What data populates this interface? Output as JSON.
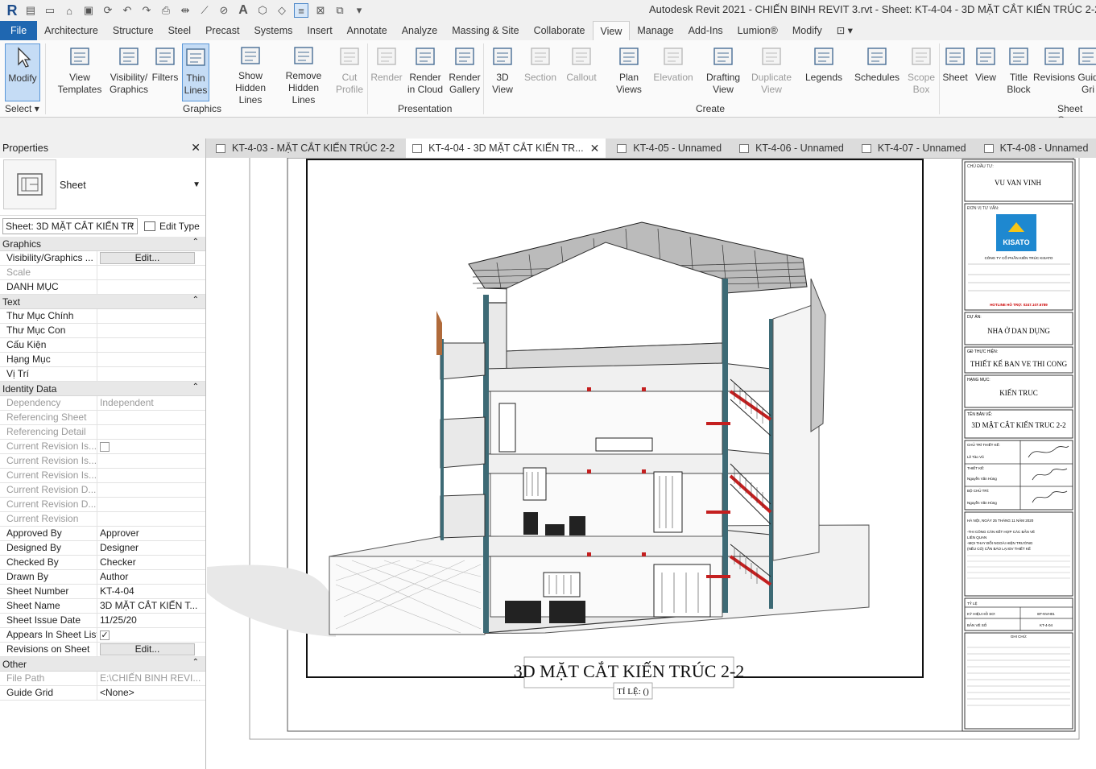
{
  "window": {
    "title": "Autodesk Revit 2021 - CHIẾN BINH REVIT 3.rvt - Sheet: KT-4-04 - 3D MẶT CẮT KIẾN TRÚC 2-2"
  },
  "ribbon_tabs": [
    "File",
    "Architecture",
    "Structure",
    "Steel",
    "Precast",
    "Systems",
    "Insert",
    "Annotate",
    "Analyze",
    "Massing & Site",
    "Collaborate",
    "View",
    "Manage",
    "Add-Ins",
    "Lumion®",
    "Modify"
  ],
  "active_tab": "View",
  "select_label": "Select",
  "ribbon_buttons": [
    {
      "l1": "Modify",
      "l2": "",
      "icon": "cursor-icon"
    },
    {
      "l1": "View",
      "l2": "Templates",
      "icon": "view-templates-icon"
    },
    {
      "l1": "Visibility/",
      "l2": "Graphics",
      "icon": "visibility-graphics-icon"
    },
    {
      "l1": "Filters",
      "l2": "",
      "icon": "filters-icon"
    },
    {
      "l1": "Thin",
      "l2": "Lines",
      "icon": "thin-lines-icon"
    },
    {
      "l1": "Show",
      "l2": "Hidden Lines",
      "icon": "show-hidden-lines-icon"
    },
    {
      "l1": "Remove",
      "l2": "Hidden Lines",
      "icon": "remove-hidden-lines-icon"
    },
    {
      "l1": "Cut",
      "l2": "Profile",
      "icon": "cut-profile-icon"
    },
    {
      "l1": "Render",
      "l2": "",
      "icon": "render-icon"
    },
    {
      "l1": "Render",
      "l2": "in Cloud",
      "icon": "render-cloud-icon"
    },
    {
      "l1": "Render",
      "l2": "Gallery",
      "icon": "render-gallery-icon"
    },
    {
      "l1": "3D",
      "l2": "View",
      "icon": "3d-view-icon"
    },
    {
      "l1": "Section",
      "l2": "",
      "icon": "section-icon"
    },
    {
      "l1": "Callout",
      "l2": "",
      "icon": "callout-icon"
    },
    {
      "l1": "Plan",
      "l2": "Views",
      "icon": "plan-views-icon"
    },
    {
      "l1": "Elevation",
      "l2": "",
      "icon": "elevation-icon"
    },
    {
      "l1": "Drafting",
      "l2": "View",
      "icon": "drafting-view-icon"
    },
    {
      "l1": "Duplicate",
      "l2": "View",
      "icon": "duplicate-view-icon"
    },
    {
      "l1": "Legends",
      "l2": "",
      "icon": "legends-icon"
    },
    {
      "l1": "Schedules",
      "l2": "",
      "icon": "schedules-icon"
    },
    {
      "l1": "Scope",
      "l2": "Box",
      "icon": "scope-box-icon"
    },
    {
      "l1": "Sheet",
      "l2": "",
      "icon": "sheet-icon"
    },
    {
      "l1": "View",
      "l2": "",
      "icon": "place-view-icon"
    },
    {
      "l1": "Title",
      "l2": "Block",
      "icon": "title-block-icon"
    },
    {
      "l1": "Revisions",
      "l2": "",
      "icon": "revisions-icon"
    },
    {
      "l1": "Guid",
      "l2": "Gri",
      "icon": "guide-grid-icon"
    }
  ],
  "ribbon_groups": [
    "Graphics",
    "Presentation",
    "Create",
    "Sheet Co"
  ],
  "properties": {
    "title": "Properties",
    "type_name": "Sheet",
    "selector": "Sheet: 3D MẶT CẮT KIẾN TR",
    "edit_type": "Edit Type",
    "sections": [
      {
        "name": "Graphics",
        "rows": [
          {
            "k": "Visibility/Graphics ...",
            "v": "Edit...",
            "btn": true
          },
          {
            "k": "Scale",
            "v": "",
            "dim": true
          },
          {
            "k": "DANH MỤC",
            "v": ""
          }
        ]
      },
      {
        "name": "Text",
        "rows": [
          {
            "k": "Thư Mục Chính",
            "v": ""
          },
          {
            "k": "Thư Mục Con",
            "v": ""
          },
          {
            "k": "Cấu Kiện",
            "v": ""
          },
          {
            "k": "Hạng Mục",
            "v": ""
          },
          {
            "k": "Vị Trí",
            "v": ""
          }
        ]
      },
      {
        "name": "Identity Data",
        "rows": [
          {
            "k": "Dependency",
            "v": "Independent",
            "dim": true
          },
          {
            "k": "Referencing Sheet",
            "v": "",
            "dim": true
          },
          {
            "k": "Referencing Detail",
            "v": "",
            "dim": true
          },
          {
            "k": "Current Revision Is...",
            "v": "",
            "dim": true,
            "chk": "unchecked"
          },
          {
            "k": "Current Revision Is...",
            "v": "",
            "dim": true
          },
          {
            "k": "Current Revision Is...",
            "v": "",
            "dim": true
          },
          {
            "k": "Current Revision D...",
            "v": "",
            "dim": true
          },
          {
            "k": "Current Revision D...",
            "v": "",
            "dim": true
          },
          {
            "k": "Current Revision",
            "v": "",
            "dim": true
          },
          {
            "k": "Approved By",
            "v": "Approver"
          },
          {
            "k": "Designed By",
            "v": "Designer"
          },
          {
            "k": "Checked By",
            "v": "Checker"
          },
          {
            "k": "Drawn By",
            "v": "Author"
          },
          {
            "k": "Sheet Number",
            "v": "KT-4-04"
          },
          {
            "k": "Sheet Name",
            "v": "3D MẶT CẮT KIẾN T..."
          },
          {
            "k": "Sheet Issue Date",
            "v": "11/25/20"
          },
          {
            "k": "Appears In Sheet List",
            "v": "",
            "chk": "checked"
          },
          {
            "k": "Revisions on Sheet",
            "v": "Edit...",
            "btn": true
          }
        ]
      },
      {
        "name": "Other",
        "rows": [
          {
            "k": "File Path",
            "v": "E:\\CHIẾN BINH REVI...",
            "dim": true
          },
          {
            "k": "Guide Grid",
            "v": "<None>"
          }
        ]
      }
    ]
  },
  "doc_tabs": [
    {
      "label": "KT-4-03 - MẶT CẮT KIẾN TRÚC 2-2",
      "active": false
    },
    {
      "label": "KT-4-04 - 3D MẶT CẮT KIẾN TR...",
      "active": true
    },
    {
      "label": "KT-4-05 - Unnamed",
      "active": false
    },
    {
      "label": "KT-4-06 - Unnamed",
      "active": false
    },
    {
      "label": "KT-4-07 - Unnamed",
      "active": false
    },
    {
      "label": "KT-4-08 - Unnamed",
      "active": false
    }
  ],
  "sheet": {
    "view_title": "3D MẶT CẮT KIẾN TRÚC 2-2",
    "scale_label": "TỈ LỆ: ()",
    "title_block": {
      "owner_label": "CHỦ ĐẦU TƯ:",
      "owner": "VU VAN VINH",
      "consultant_label": "ĐƠN VỊ TƯ VẤN:",
      "logo_text": "KISATO",
      "company": "CÔNG TY CỔ PHẦN KIẾN TRÚC KISATO",
      "hotline": "HOTLINE HỖ TRỢ: 0247.107.6789",
      "project_label": "DỰ ÁN:",
      "project": "NHA Ở DAN DỤNG",
      "stage_label": "GĐ THỰC HIỆN:",
      "stage": "THIẾT KẾ BAN VE THI CONG",
      "item_label": "HẠNG MỤC:",
      "item": "KIẾN TRUC",
      "drawing_label": "TÊN BẢN VẼ:",
      "drawing": "3D MẶT CẮT KIẾN TRUC 2-2",
      "sign_rows": [
        {
          "role": "CHỦ TRÌ THIẾT KẾ:",
          "name": "Lê Tào Vũ"
        },
        {
          "role": "THIẾT KẾ:",
          "name": "Nguyễn Văn Hùng"
        },
        {
          "role": "BỘ CHỦ TRÌ:",
          "name": "Nguyễn Văn Hùng"
        }
      ],
      "date_line": "HÀ NỘI, NGÀY 25 THÁNG 11 NĂM 2020",
      "notes_lines": [
        "-THI CÔNG CĂN KẾT HỢP CÁC BẢN VẼ",
        "LIÊN QUAN",
        "-MỌI THAY ĐỔI NGOÀI HIỆN TRƯỜNG",
        "(NẾU CÓ) CẦN BÁO LẠI ĐV THIẾT KẾ"
      ],
      "scale_label": "TỶ LỆ",
      "code_label": "KÝ HIỆU HỒ SƠ:",
      "code": "BT-NVH01",
      "sheet_label": "BẢN VẼ SỐ",
      "sheet_no": "KT-4-04",
      "remark_label": "GHI CHÚ:"
    }
  }
}
